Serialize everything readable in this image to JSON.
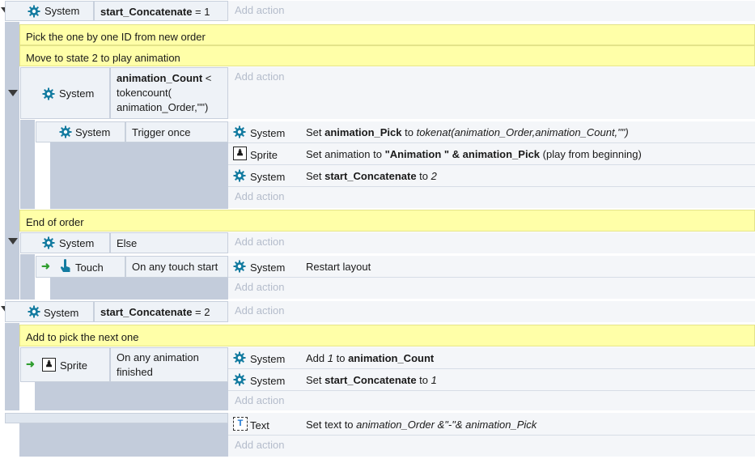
{
  "add_action": "Add action",
  "events": {
    "e1": {
      "object": "System",
      "cond_var": "start_Concatenate",
      "cond_rest": " = 1"
    },
    "c1": "Pick the one by one ID from new order",
    "c2": "Move to state 2 to play animation",
    "e2": {
      "object": "System",
      "cond_var": "animation_Count",
      "cond_line1_rest": " <",
      "cond_line2": "tokencount(",
      "cond_line3": "animation_Order,\"\")"
    },
    "e3": {
      "object": "System",
      "cond": "Trigger once",
      "actions": [
        {
          "object": "System",
          "icon": "gear-icon",
          "pre": "Set ",
          "bold": "animation_Pick",
          "mid": " to ",
          "italic": "tokenat(animation_Order,animation_Count,\"\")",
          "post": ""
        },
        {
          "object": "Sprite",
          "icon": "sprite-icon",
          "pre": "Set animation to ",
          "bold": "\"Animation \" & animation_Pick",
          "mid": " (play from beginning)",
          "italic": "",
          "post": ""
        },
        {
          "object": "System",
          "icon": "gear-icon",
          "pre": "Set ",
          "bold": "start_Concatenate",
          "mid": " to ",
          "italic": "2",
          "post": ""
        }
      ]
    },
    "c3": "End of order",
    "e4": {
      "object": "System",
      "cond": "Else"
    },
    "e5": {
      "object": "Touch",
      "cond": "On any touch start",
      "action_object": "System",
      "action_text": "Restart layout"
    },
    "e6": {
      "object": "System",
      "cond_var": "start_Concatenate",
      "cond_rest": " = 2"
    },
    "c4": "Add to pick the next one",
    "e7": {
      "object": "Sprite",
      "cond_line1": "On any animation",
      "cond_line2": "finished",
      "actions": [
        {
          "object": "System",
          "pre": "Add ",
          "italic": "1",
          "mid": " to ",
          "bold": "animation_Count"
        },
        {
          "object": "System",
          "pre": "Set ",
          "bold": "start_Concatenate",
          "mid": " to ",
          "italic": "1"
        }
      ]
    },
    "e8": {
      "action_object": "Text",
      "pre": "Set text to ",
      "italic": "animation_Order &\"-\"& animation_Pick"
    }
  },
  "colors": {
    "gear": "#137ba0",
    "comment": "#ffffa8",
    "block": "#c3ccdb",
    "add_action": "#b4bccb"
  }
}
